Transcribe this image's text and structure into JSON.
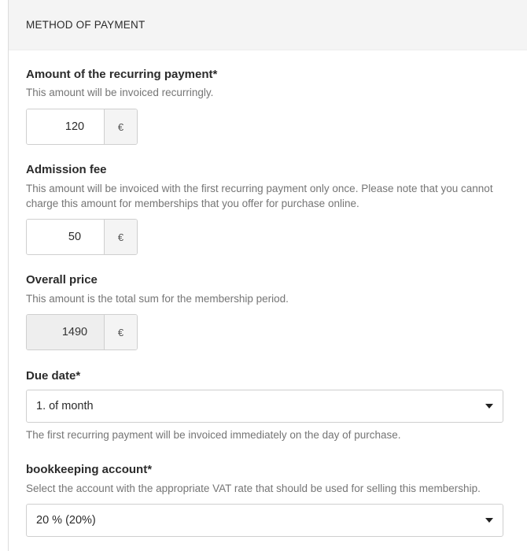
{
  "panel": {
    "title": "METHOD OF PAYMENT"
  },
  "recurring": {
    "label": "Amount of the recurring payment*",
    "help": "This amount will be invoiced recurringly.",
    "value": "120",
    "currency": "€"
  },
  "admission": {
    "label": "Admission fee",
    "help_line1": "This amount will be invoiced with the first recurring payment only once. Please note that you cannot",
    "help_line2": "charge this amount for memberships that you offer for purchase online.",
    "value": "50",
    "currency": "€"
  },
  "overall": {
    "label": "Overall price",
    "help": "This amount is the total sum for the membership period.",
    "value": "1490",
    "currency": "€"
  },
  "due_date": {
    "label": "Due date*",
    "selected": "1. of month",
    "help": "The first recurring payment will be invoiced immediately on the day of purchase."
  },
  "bookkeeping": {
    "label": "bookkeeping account*",
    "help": "Select the account with the appropriate VAT rate that should be used for selling this membership.",
    "selected": "20 % (20%)"
  }
}
